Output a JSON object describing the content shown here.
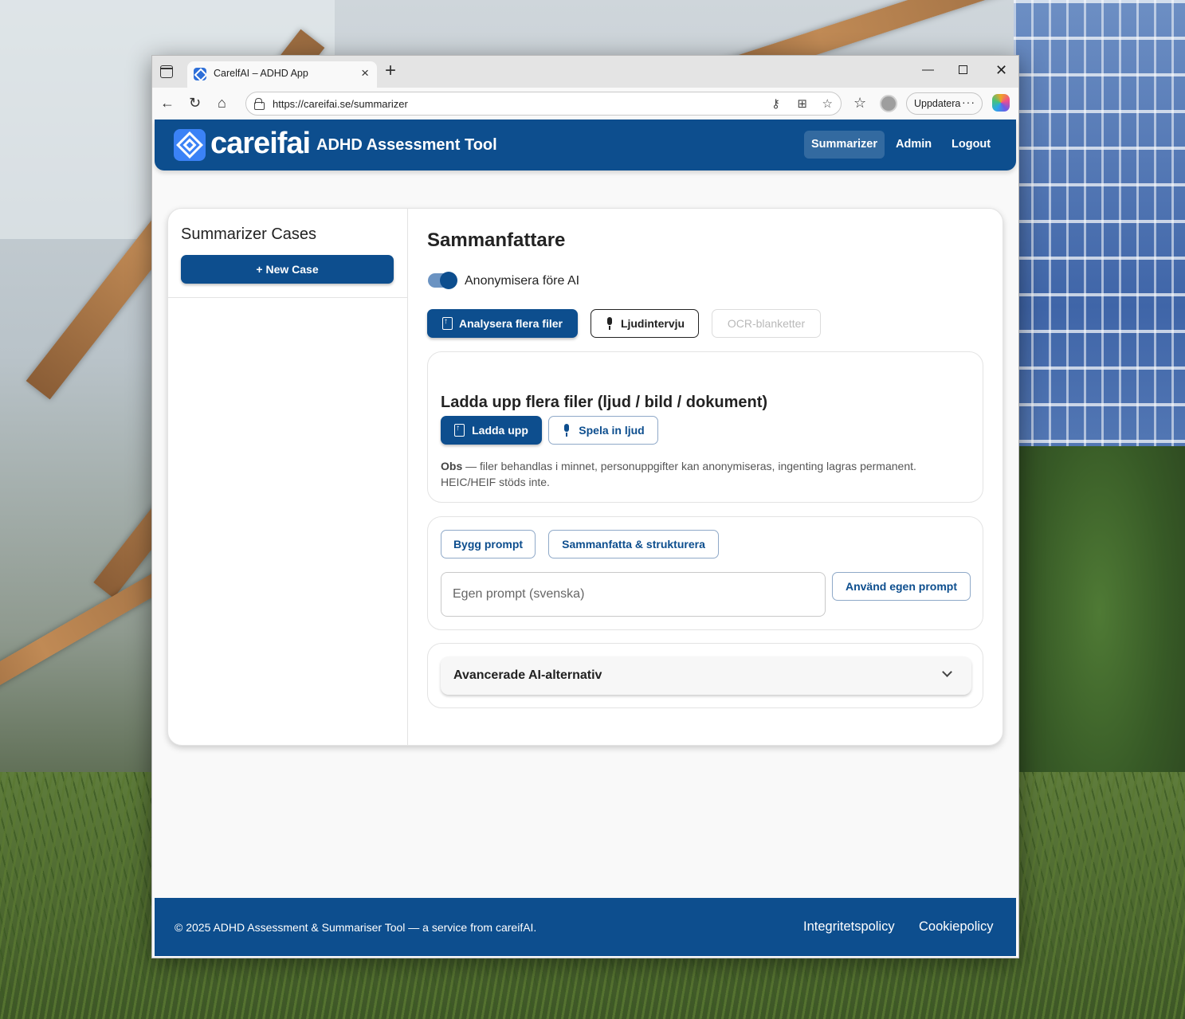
{
  "browser": {
    "tab_title": "CarelfAI – ADHD App",
    "tab_close": "×",
    "new_tab": "+",
    "url": "https://careifai.se/summarizer",
    "update_label": "Uppdatera",
    "more": "···",
    "window_min": "—",
    "window_close": "✕",
    "icons": [
      "sidebar-icon",
      "back-icon",
      "reload-icon",
      "home-icon",
      "lock-icon",
      "key-icon",
      "apps-icon",
      "star-icon",
      "favorites-icon",
      "profile-icon",
      "copilot-icon"
    ]
  },
  "header": {
    "logo_text": "careifai",
    "title": "ADHD Assessment Tool",
    "nav": [
      {
        "label": "Summarizer",
        "active": true
      },
      {
        "label": "Admin",
        "active": false
      },
      {
        "label": "Logout",
        "active": false
      }
    ]
  },
  "sidebar": {
    "title": "Summarizer Cases",
    "new_case_label": "+ New Case"
  },
  "main": {
    "title": "Sammanfattare",
    "anonymize": {
      "label": "Anonymisera före AI",
      "on": true
    },
    "modes": [
      {
        "label": "Analysera flera filer",
        "active": true,
        "icon": "file-upload-icon"
      },
      {
        "label": "Ljudintervju",
        "active": false,
        "icon": "microphone-icon"
      },
      {
        "label": "OCR-blanketter",
        "active": false,
        "disabled": true
      }
    ],
    "upload": {
      "title": "Ladda upp flera filer (ljud / bild / dokument)",
      "upload_label": "Ladda upp",
      "record_label": "Spela in ljud",
      "note_bold": "Obs",
      "note_text": " — filer behandlas i minnet, personuppgifter kan anonymiseras, ingenting lagras permanent. HEIC/HEIF stöds inte."
    },
    "prompt": {
      "build_label": "Bygg prompt",
      "summarize_label": "Sammanfatta & strukturera",
      "input_placeholder": "Egen prompt (svenska)",
      "input_value": "",
      "custom_label": "Använd egen prompt"
    },
    "advanced": {
      "title": "Avancerade AI-alternativ",
      "expanded": false
    }
  },
  "footer": {
    "copyright": "© 2025 ADHD Assessment & Summariser Tool — a service from careifAI.",
    "privacy": "Integritetspolicy",
    "cookie": "Cookiepolicy"
  },
  "colors": {
    "brand": "#0d4e8e",
    "accent": "#3b82f6",
    "page_bg": "#f9f9f9"
  }
}
